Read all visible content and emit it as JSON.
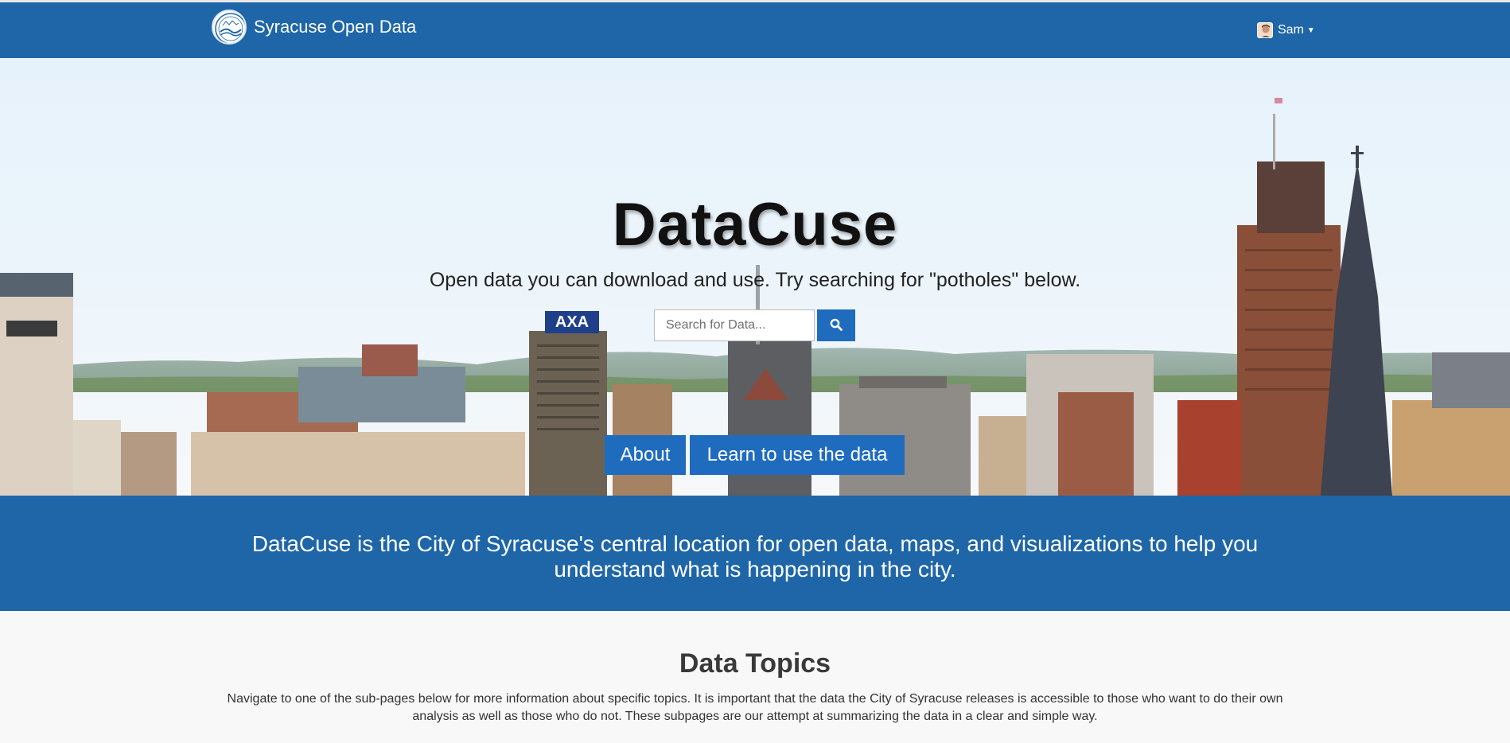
{
  "navbar": {
    "brand_text": "Syracuse Open Data",
    "user_name": "Sam"
  },
  "hero": {
    "title": "DataCuse",
    "subtitle": "Open data you can download and use. Try searching for \"potholes\" below.",
    "search_placeholder": "Search for Data...",
    "about_label": "About",
    "learn_label": "Learn to use the data"
  },
  "band": {
    "text": "DataCuse is the City of Syracuse's central location for open data, maps, and visualizations to help you understand what is happening in the city."
  },
  "topics": {
    "title": "Data Topics",
    "description": "Navigate to one of the sub-pages below for more information about specific topics. It is important that the data the City of Syracuse releases is accessible to those who want to do their own analysis as well as those who do not. These subpages are our attempt at summarizing the data in a clear and simple way."
  },
  "icons": {
    "logo": "city-seal-logo",
    "avatar": "user-avatar",
    "caret": "caret-down-icon",
    "search": "search-icon"
  },
  "colors": {
    "brand_blue": "#1e66a8",
    "button_blue": "#1f6cbf",
    "page_background": "#f8f8f8"
  }
}
